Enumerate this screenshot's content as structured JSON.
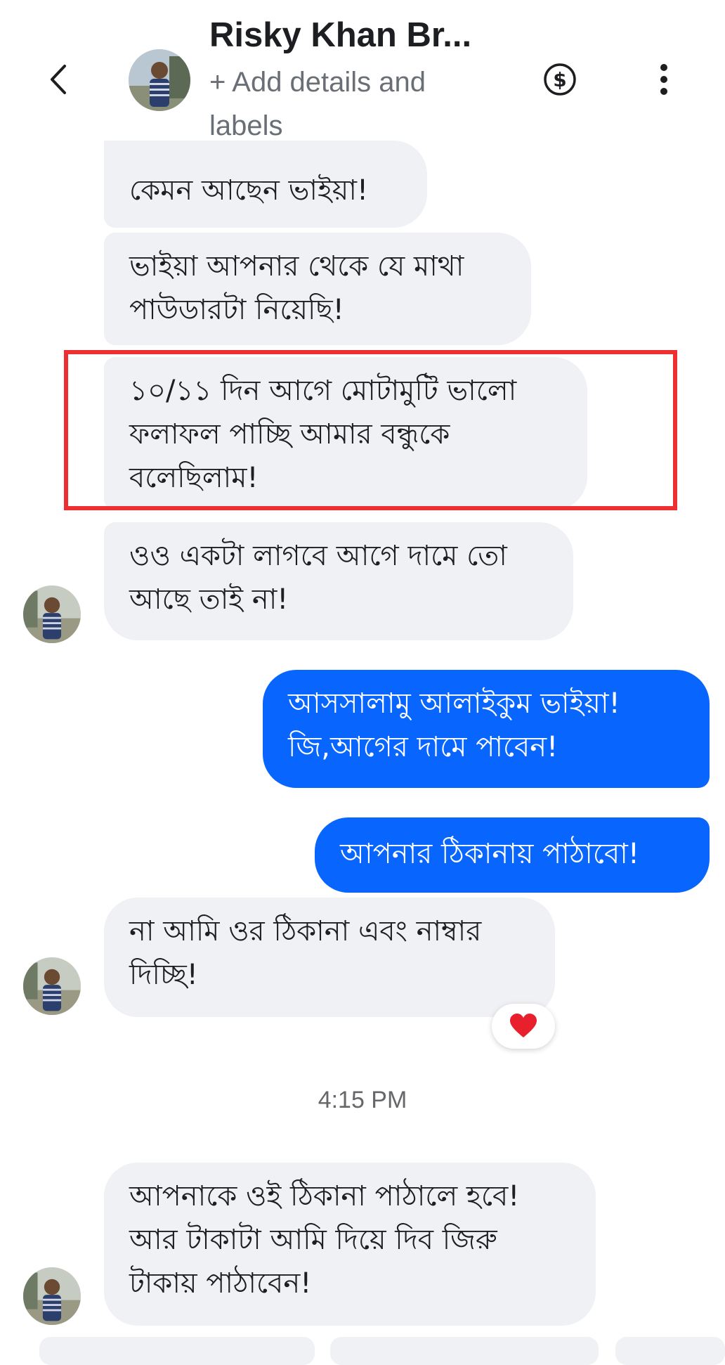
{
  "header": {
    "title": "Risky Khan Br...",
    "subtitle": "+ Add details and labels",
    "icons": [
      "back-chevron-icon",
      "dollar-circle-icon",
      "more-vertical-icon"
    ]
  },
  "messages": [
    {
      "direction": "incoming",
      "text": "কেমন আছেন ভাইয়া!"
    },
    {
      "direction": "incoming",
      "text": "ভাইয়া আপনার থেকে যে মাথা\nপাউডারটা নিয়েছি!"
    },
    {
      "direction": "incoming",
      "text": "১০/১১ দিন  আগে মোটামুটি ভালো\nফলাফল পাচ্ছি আমার বন্ধুকে\nবলেছিলাম!",
      "highlighted": true
    },
    {
      "direction": "incoming",
      "text": "ওও একটা লাগবে আগে দামে তো\nআছে তাই না!"
    },
    {
      "direction": "outgoing",
      "text": "আসসালামু আলাইকুম ভাইয়া!\nজি,আগের দামে পাবেন!"
    },
    {
      "direction": "outgoing",
      "text": "আপনার ঠিকানায় পাঠাবো!"
    },
    {
      "direction": "incoming",
      "text": "না আমি ওর ঠিকানা এবং নাম্বার\nদিচ্ছি!",
      "reaction": "heart-icon"
    },
    {
      "direction": "incoming",
      "text": "আপনাকে ওই ঠিকানা পাঠালে হবে!\nআর টাকাটা আমি দিয়ে দিব জিরু\nটাকায় পাঠাবেন!"
    }
  ],
  "timestamp": "4:15 PM",
  "colors": {
    "incoming_bubble": "#f0f1f4",
    "outgoing_bubble": "#0866ff",
    "highlight_border": "#ee2f32",
    "heart": "#e8202e"
  }
}
